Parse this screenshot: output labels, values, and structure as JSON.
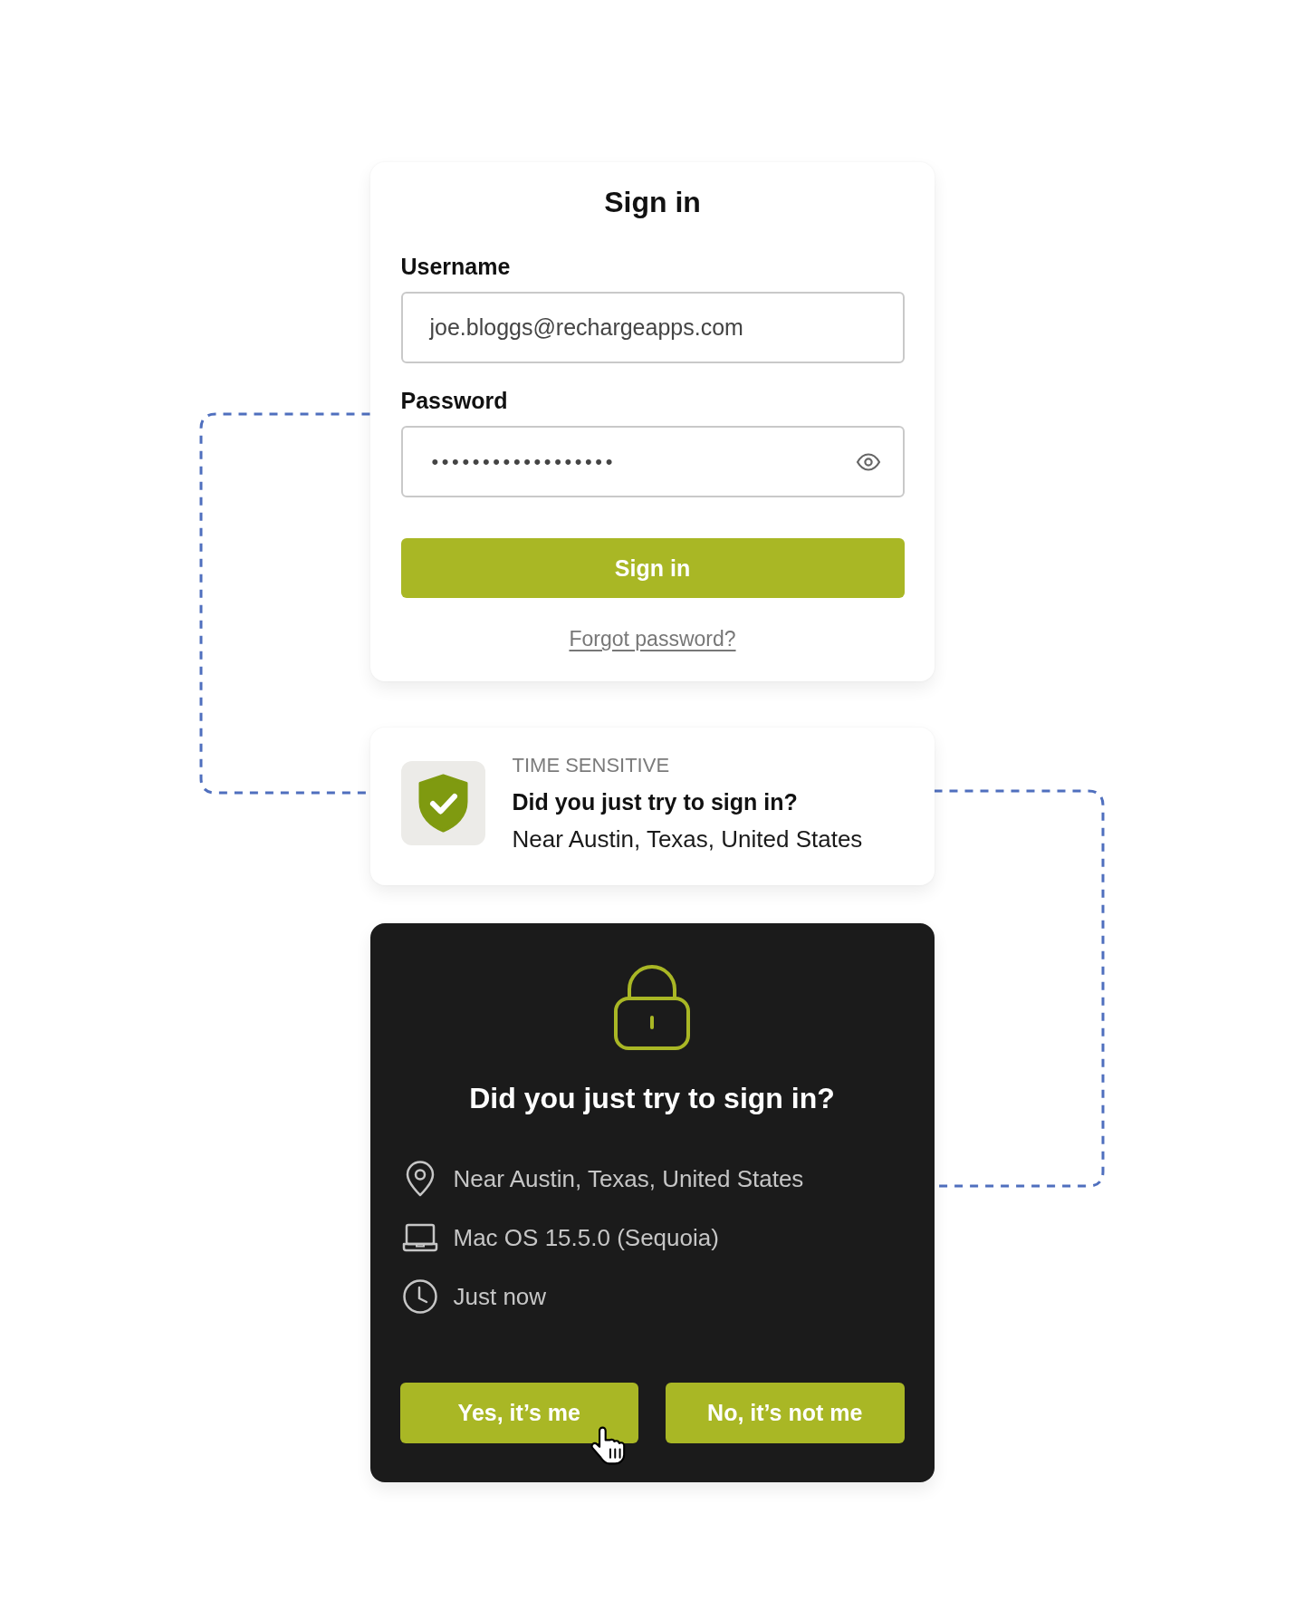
{
  "sign_in_card": {
    "title": "Sign in",
    "fields": [
      {
        "label": "Username",
        "kind": "text",
        "value": "joe.bloggs@rechargeapps.com"
      },
      {
        "label": "Password",
        "kind": "password",
        "value": "••••••••••••••••••"
      }
    ],
    "submit_button": "Sign in",
    "forgot_link": "Forgot password?"
  },
  "notification": {
    "category": "TIME SENSITIVE",
    "title": "Did you just try to sign in?",
    "body": "Near Austin, Texas, United States"
  },
  "verification_card": {
    "title": "Did you just try to sign in?",
    "details": [
      {
        "kind": "location",
        "text": "Near Austin, Texas, United States"
      },
      {
        "kind": "device",
        "text": "Mac OS 15.5.0 (Sequoia)"
      },
      {
        "kind": "time",
        "text": "Just now"
      }
    ],
    "buttons": [
      {
        "label": "Yes, it’s me",
        "hovered": true
      },
      {
        "label": "No, it’s not me",
        "hovered": false
      }
    ]
  }
}
